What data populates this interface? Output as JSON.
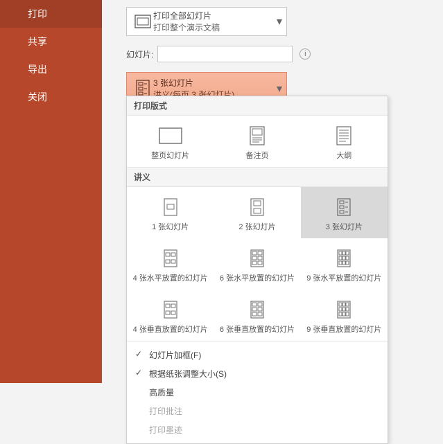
{
  "sidebar": {
    "items": [
      {
        "label": "打印"
      },
      {
        "label": "共享"
      },
      {
        "label": "导出"
      },
      {
        "label": "关闭"
      }
    ]
  },
  "printAll": {
    "title": "打印全部幻灯片",
    "subtitle": "打印整个演示文稿"
  },
  "slidesLabel": "幻灯片:",
  "slidesValue": "",
  "layoutDropdown": {
    "title": "3 张幻灯片",
    "subtitle": "讲义(每页 3 张幻灯片)"
  },
  "popup": {
    "sectionLayout": "打印版式",
    "layoutItems": [
      {
        "label": "整页幻灯片"
      },
      {
        "label": "备注页"
      },
      {
        "label": "大纲"
      }
    ],
    "sectionHandout": "讲义",
    "handoutItems": [
      {
        "label": "1 张幻灯片"
      },
      {
        "label": "2 张幻灯片"
      },
      {
        "label": "3 张幻灯片"
      },
      {
        "label": "4 张水平放置的幻灯片"
      },
      {
        "label": "6 张水平放置的幻灯片"
      },
      {
        "label": "9 张水平放置的幻灯片"
      },
      {
        "label": "4 张垂直放置的幻灯片"
      },
      {
        "label": "6 张垂直放置的幻灯片"
      },
      {
        "label": "9 张垂直放置的幻灯片"
      }
    ],
    "options": {
      "frame": "幻灯片加框(F)",
      "autosize": "根据纸张调整大小(S)",
      "highQuality": "高质量",
      "printComments": "打印批注",
      "printInk": "打印墨迹"
    }
  }
}
